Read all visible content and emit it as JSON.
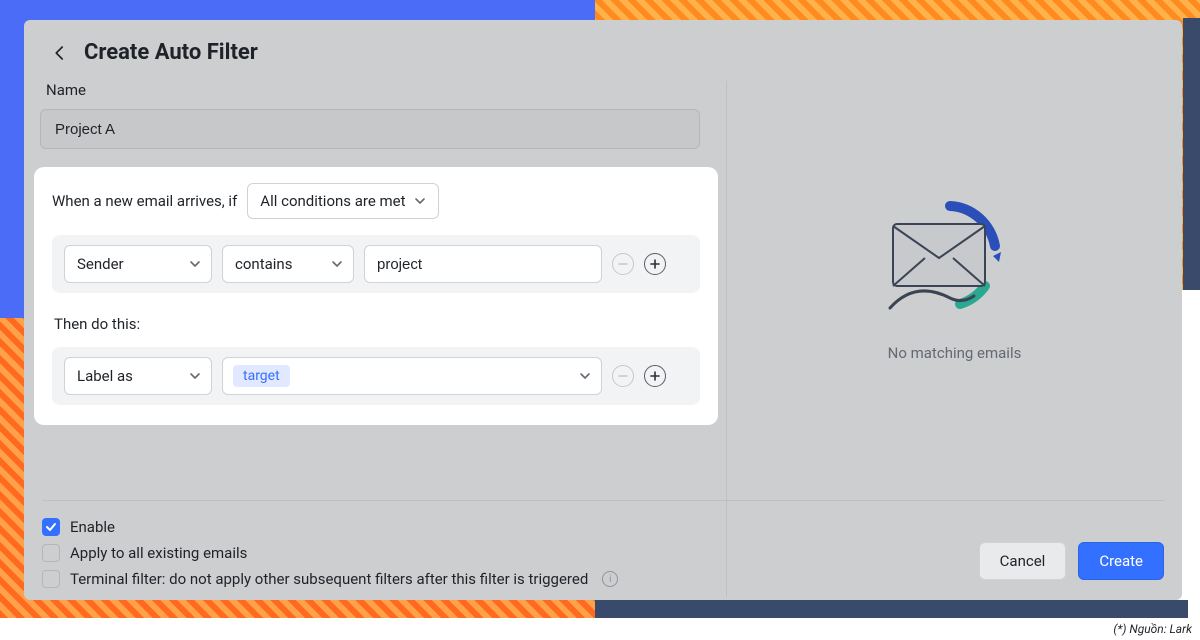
{
  "header": {
    "title": "Create Auto Filter"
  },
  "name_field": {
    "label": "Name",
    "value": "Project A"
  },
  "conditions": {
    "intro": "When a new email arrives, if",
    "match_mode": "All conditions are met",
    "rows": [
      {
        "field": "Sender",
        "operator": "contains",
        "value": "project"
      }
    ]
  },
  "actions": {
    "intro": "Then do this:",
    "rows": [
      {
        "action": "Label as",
        "value": "target"
      }
    ]
  },
  "footer": {
    "enable_label": "Enable",
    "apply_existing_label": "Apply to all existing emails",
    "terminal_label": "Terminal filter: do not apply other subsequent filters after this filter is triggered",
    "enable_checked": true,
    "apply_existing_checked": false,
    "terminal_checked": false,
    "cancel": "Cancel",
    "create": "Create"
  },
  "preview": {
    "empty_text": "No matching emails"
  },
  "source_note": "(*) Nguồn: Lark"
}
